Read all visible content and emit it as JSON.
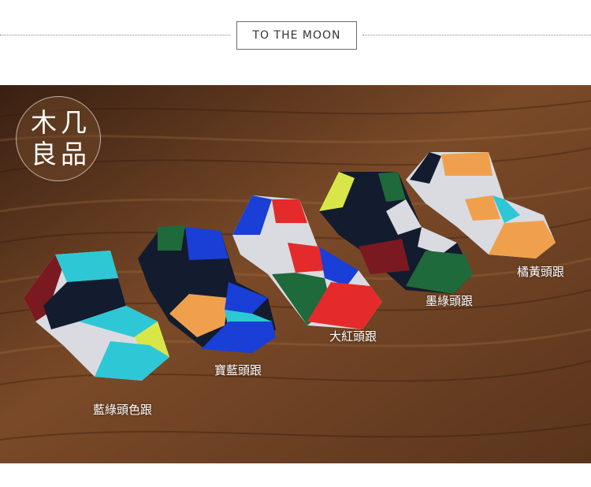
{
  "header": {
    "title": "TO THE MOON"
  },
  "logo": {
    "chars": [
      "木",
      "几",
      "良",
      "品"
    ]
  },
  "labels": {
    "blue_green": "藍綠頭色跟",
    "royal_blue": "寶藍頭跟",
    "big_red": "大紅頭跟",
    "ink_green": "墨綠頭跟",
    "orange_yellow": "橘黃頭跟"
  },
  "colors": {
    "wood_dark": "#4a2a16",
    "wood_mid": "#7a4a2a",
    "wood_light": "#9a6a44",
    "cyan": "#2ec7d6",
    "lime": "#d9e64a",
    "navy": "#131b2e",
    "royal_blue": "#1a3fd6",
    "orange": "#f0a04c",
    "red": "#e42a2a",
    "green": "#1f6a3a",
    "maroon": "#7a1a20",
    "grey": "#d9dbe0"
  }
}
